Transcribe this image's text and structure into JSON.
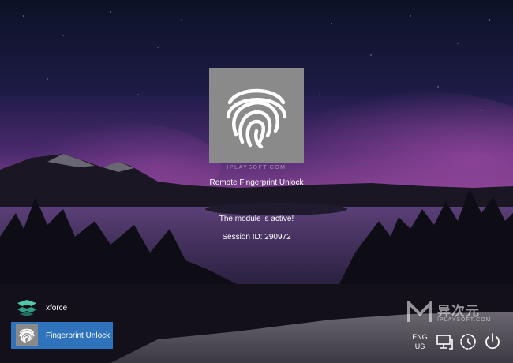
{
  "lock_screen": {
    "title": "Remote Fingerprint Unlock",
    "status": "The module is active!",
    "session_label": "Session ID:",
    "session_id": "290972",
    "watermark_small": "IPLAYSOFT.COM"
  },
  "users": [
    {
      "name": "xforce",
      "avatar_icon": "xforce-logo-icon",
      "selected": false
    },
    {
      "name": "Fingerprint Unlock",
      "avatar_icon": "fingerprint-icon",
      "selected": true,
      "accent": "#2f73bd"
    }
  ],
  "brand": {
    "cn": "异次元",
    "en": "IPLAYSOFT.COM"
  },
  "taskbar": {
    "language_top": "ENG",
    "language_bottom": "US",
    "icons": [
      "network-icon",
      "ease-of-access-icon",
      "power-icon"
    ]
  },
  "colors": {
    "selected_user_bg": "#2f73bd",
    "tile_bg": "#8a8a8a"
  }
}
